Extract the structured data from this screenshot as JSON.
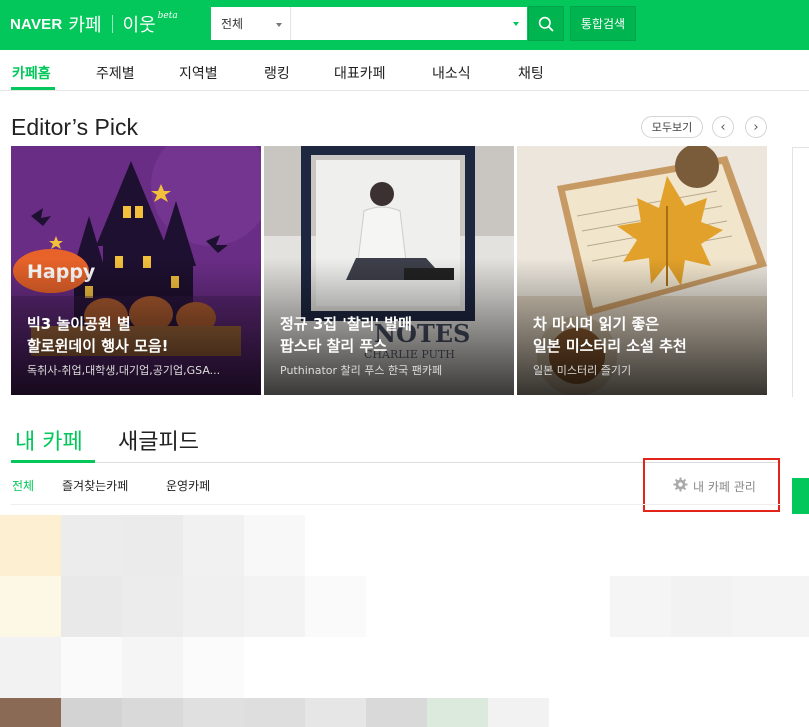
{
  "header": {
    "logo_naver": "NAVER",
    "logo_cafe": "카페",
    "logo_iut": "이웃",
    "logo_beta": "beta",
    "search_category": "전체",
    "search_value": "",
    "search_icon": "search-icon",
    "unified_search_label": "통합검색"
  },
  "nav": {
    "items": [
      {
        "label": "카페홈",
        "active": true
      },
      {
        "label": "주제별"
      },
      {
        "label": "지역별"
      },
      {
        "label": "랭킹"
      },
      {
        "label": "대표카페"
      },
      {
        "label": "내소식"
      },
      {
        "label": "채팅"
      }
    ]
  },
  "editors_pick": {
    "title": "Editor’s Pick",
    "more_label": "모두보기",
    "prev_icon": "chevron-left-icon",
    "next_icon": "chevron-right-icon",
    "cards": [
      {
        "title": "빅3 놀이공원 별\n할로윈데이 행사 모음!",
        "subtitle": "독취사-취업,대학생,대기업,공기업,GSA...",
        "image": "halloween-image"
      },
      {
        "title": "정규 3집 '찰리' 발매\n팝스타 찰리 푸스",
        "subtitle": "Puthinator 찰리 푸스 한국 팬카페",
        "image": "charlie-puth-album-image"
      },
      {
        "title": "차 마시며 읽기 좋은\n일본 미스터리 소설 추천",
        "subtitle": "일본 미스터리 즐기기",
        "image": "autumn-book-image"
      }
    ]
  },
  "my_cafe": {
    "tab_mycafe": "내 카페",
    "tab_newfeed": "새글피드",
    "subtabs": [
      "전체",
      "즐겨찾는카페",
      "운영카페"
    ],
    "manage_label": "내 카페 관리",
    "manage_icon": "gear-icon"
  },
  "colors": {
    "brand": "#03c75a",
    "highlight_box": "#e1251b"
  }
}
